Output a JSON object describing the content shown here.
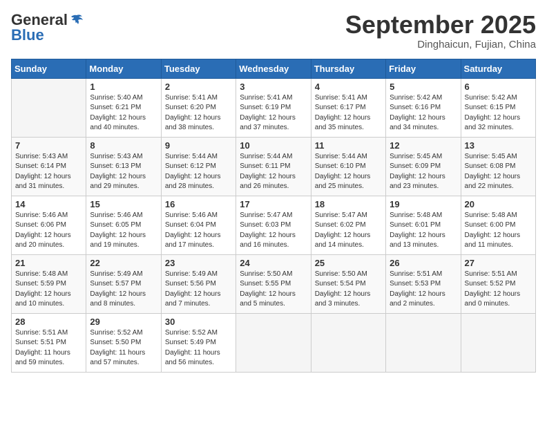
{
  "header": {
    "logo_line1": "General",
    "logo_line2": "Blue",
    "month": "September 2025",
    "location": "Dinghaicun, Fujian, China"
  },
  "weekdays": [
    "Sunday",
    "Monday",
    "Tuesday",
    "Wednesday",
    "Thursday",
    "Friday",
    "Saturday"
  ],
  "weeks": [
    [
      {
        "day": "",
        "content": ""
      },
      {
        "day": "1",
        "content": "Sunrise: 5:40 AM\nSunset: 6:21 PM\nDaylight: 12 hours\nand 40 minutes."
      },
      {
        "day": "2",
        "content": "Sunrise: 5:41 AM\nSunset: 6:20 PM\nDaylight: 12 hours\nand 38 minutes."
      },
      {
        "day": "3",
        "content": "Sunrise: 5:41 AM\nSunset: 6:19 PM\nDaylight: 12 hours\nand 37 minutes."
      },
      {
        "day": "4",
        "content": "Sunrise: 5:41 AM\nSunset: 6:17 PM\nDaylight: 12 hours\nand 35 minutes."
      },
      {
        "day": "5",
        "content": "Sunrise: 5:42 AM\nSunset: 6:16 PM\nDaylight: 12 hours\nand 34 minutes."
      },
      {
        "day": "6",
        "content": "Sunrise: 5:42 AM\nSunset: 6:15 PM\nDaylight: 12 hours\nand 32 minutes."
      }
    ],
    [
      {
        "day": "7",
        "content": "Sunrise: 5:43 AM\nSunset: 6:14 PM\nDaylight: 12 hours\nand 31 minutes."
      },
      {
        "day": "8",
        "content": "Sunrise: 5:43 AM\nSunset: 6:13 PM\nDaylight: 12 hours\nand 29 minutes."
      },
      {
        "day": "9",
        "content": "Sunrise: 5:44 AM\nSunset: 6:12 PM\nDaylight: 12 hours\nand 28 minutes."
      },
      {
        "day": "10",
        "content": "Sunrise: 5:44 AM\nSunset: 6:11 PM\nDaylight: 12 hours\nand 26 minutes."
      },
      {
        "day": "11",
        "content": "Sunrise: 5:44 AM\nSunset: 6:10 PM\nDaylight: 12 hours\nand 25 minutes."
      },
      {
        "day": "12",
        "content": "Sunrise: 5:45 AM\nSunset: 6:09 PM\nDaylight: 12 hours\nand 23 minutes."
      },
      {
        "day": "13",
        "content": "Sunrise: 5:45 AM\nSunset: 6:08 PM\nDaylight: 12 hours\nand 22 minutes."
      }
    ],
    [
      {
        "day": "14",
        "content": "Sunrise: 5:46 AM\nSunset: 6:06 PM\nDaylight: 12 hours\nand 20 minutes."
      },
      {
        "day": "15",
        "content": "Sunrise: 5:46 AM\nSunset: 6:05 PM\nDaylight: 12 hours\nand 19 minutes."
      },
      {
        "day": "16",
        "content": "Sunrise: 5:46 AM\nSunset: 6:04 PM\nDaylight: 12 hours\nand 17 minutes."
      },
      {
        "day": "17",
        "content": "Sunrise: 5:47 AM\nSunset: 6:03 PM\nDaylight: 12 hours\nand 16 minutes."
      },
      {
        "day": "18",
        "content": "Sunrise: 5:47 AM\nSunset: 6:02 PM\nDaylight: 12 hours\nand 14 minutes."
      },
      {
        "day": "19",
        "content": "Sunrise: 5:48 AM\nSunset: 6:01 PM\nDaylight: 12 hours\nand 13 minutes."
      },
      {
        "day": "20",
        "content": "Sunrise: 5:48 AM\nSunset: 6:00 PM\nDaylight: 12 hours\nand 11 minutes."
      }
    ],
    [
      {
        "day": "21",
        "content": "Sunrise: 5:48 AM\nSunset: 5:59 PM\nDaylight: 12 hours\nand 10 minutes."
      },
      {
        "day": "22",
        "content": "Sunrise: 5:49 AM\nSunset: 5:57 PM\nDaylight: 12 hours\nand 8 minutes."
      },
      {
        "day": "23",
        "content": "Sunrise: 5:49 AM\nSunset: 5:56 PM\nDaylight: 12 hours\nand 7 minutes."
      },
      {
        "day": "24",
        "content": "Sunrise: 5:50 AM\nSunset: 5:55 PM\nDaylight: 12 hours\nand 5 minutes."
      },
      {
        "day": "25",
        "content": "Sunrise: 5:50 AM\nSunset: 5:54 PM\nDaylight: 12 hours\nand 3 minutes."
      },
      {
        "day": "26",
        "content": "Sunrise: 5:51 AM\nSunset: 5:53 PM\nDaylight: 12 hours\nand 2 minutes."
      },
      {
        "day": "27",
        "content": "Sunrise: 5:51 AM\nSunset: 5:52 PM\nDaylight: 12 hours\nand 0 minutes."
      }
    ],
    [
      {
        "day": "28",
        "content": "Sunrise: 5:51 AM\nSunset: 5:51 PM\nDaylight: 11 hours\nand 59 minutes."
      },
      {
        "day": "29",
        "content": "Sunrise: 5:52 AM\nSunset: 5:50 PM\nDaylight: 11 hours\nand 57 minutes."
      },
      {
        "day": "30",
        "content": "Sunrise: 5:52 AM\nSunset: 5:49 PM\nDaylight: 11 hours\nand 56 minutes."
      },
      {
        "day": "",
        "content": ""
      },
      {
        "day": "",
        "content": ""
      },
      {
        "day": "",
        "content": ""
      },
      {
        "day": "",
        "content": ""
      }
    ]
  ]
}
